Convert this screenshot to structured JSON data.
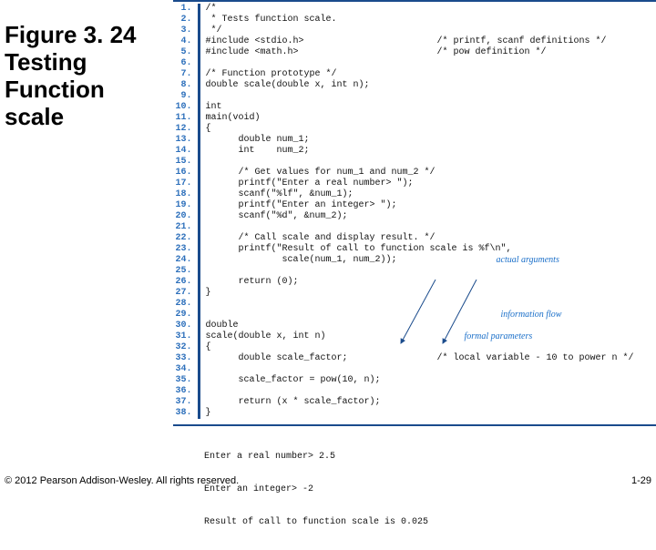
{
  "title": "Figure 3. 24 Testing Function scale",
  "code": {
    "lines": [
      {
        "n": "1.",
        "t": "/*"
      },
      {
        "n": "2.",
        "t": " * Tests function scale."
      },
      {
        "n": "3.",
        "t": " */"
      },
      {
        "n": "4.",
        "t": "#include <stdio.h>",
        "r": "/* printf, scanf definitions */"
      },
      {
        "n": "5.",
        "t": "#include <math.h>",
        "r": "/* pow definition */"
      },
      {
        "n": "6.",
        "t": ""
      },
      {
        "n": "7.",
        "t": "/* Function prototype */"
      },
      {
        "n": "8.",
        "t": "double scale(double x, int n);"
      },
      {
        "n": "9.",
        "t": ""
      },
      {
        "n": "10.",
        "t": "int"
      },
      {
        "n": "11.",
        "t": "main(void)"
      },
      {
        "n": "12.",
        "t": "{"
      },
      {
        "n": "13.",
        "t": "      double num_1;"
      },
      {
        "n": "14.",
        "t": "      int    num_2;"
      },
      {
        "n": "15.",
        "t": ""
      },
      {
        "n": "16.",
        "t": "      /* Get values for num_1 and num_2 */"
      },
      {
        "n": "17.",
        "t": "      printf(\"Enter a real number> \");"
      },
      {
        "n": "18.",
        "t": "      scanf(\"%lf\", &num_1);"
      },
      {
        "n": "19.",
        "t": "      printf(\"Enter an integer> \");"
      },
      {
        "n": "20.",
        "t": "      scanf(\"%d\", &num_2);"
      },
      {
        "n": "21.",
        "t": ""
      },
      {
        "n": "22.",
        "t": "      /* Call scale and display result. */"
      },
      {
        "n": "23.",
        "t": "      printf(\"Result of call to function scale is %f\\n\","
      },
      {
        "n": "24.",
        "t": "              scale(num_1, num_2));",
        "a": "actual arguments"
      },
      {
        "n": "25.",
        "t": ""
      },
      {
        "n": "26.",
        "t": "      return (0);"
      },
      {
        "n": "27.",
        "t": "}"
      },
      {
        "n": "28.",
        "t": ""
      },
      {
        "n": "29.",
        "t": "",
        "a": "information flow"
      },
      {
        "n": "30.",
        "t": "double"
      },
      {
        "n": "31.",
        "t": "scale(double x, int n)",
        "a": "formal parameters"
      },
      {
        "n": "32.",
        "t": "{"
      },
      {
        "n": "33.",
        "t": "      double scale_factor;",
        "r": "/* local variable - 10 to power n */"
      },
      {
        "n": "34.",
        "t": ""
      },
      {
        "n": "35.",
        "t": "      scale_factor = pow(10, n);"
      },
      {
        "n": "36.",
        "t": ""
      },
      {
        "n": "37.",
        "t": "      return (x * scale_factor);"
      },
      {
        "n": "38.",
        "t": "}"
      }
    ]
  },
  "output": {
    "line1": "Enter a real number> 2.5",
    "line2": "Enter an integer> -2",
    "line3": "Result of call to function scale is 0.025"
  },
  "footer": "© 2012 Pearson Addison-Wesley. All rights reserved.",
  "pagenum": "1-29"
}
